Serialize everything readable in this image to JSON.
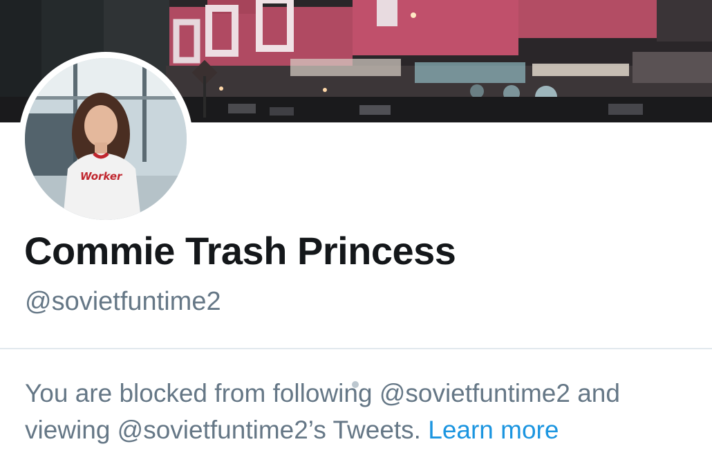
{
  "profile": {
    "display_name": "Commie Trash Princess",
    "handle": "@sovietfuntime2"
  },
  "blocked_notice": {
    "text": "You are blocked from following @sovietfuntime2 and viewing @sovietfuntime2’s Tweets.",
    "link_label": "Learn more"
  },
  "avatar_shirt_text": "Worker",
  "colors": {
    "name": "#14171a",
    "secondary_text": "#657786",
    "link": "#1b95e0",
    "divider": "#e1e8ed"
  }
}
